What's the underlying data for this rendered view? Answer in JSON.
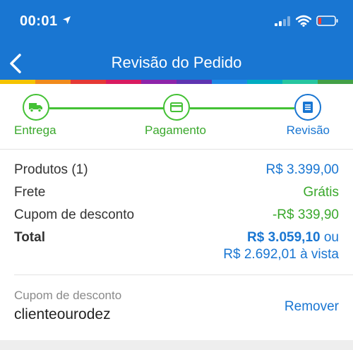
{
  "status_bar": {
    "time": "00:01",
    "icons": [
      "location-arrow-icon",
      "cellular-signal-icon",
      "wifi-icon",
      "low-battery-icon"
    ]
  },
  "nav": {
    "title": "Revisão do Pedido",
    "back_icon": "chevron-left-icon"
  },
  "colors": {
    "header": "#1976d2",
    "accent_green": "#44c135",
    "stripe": [
      "#f5c400",
      "#f08a1c",
      "#e53935",
      "#d81b60",
      "#8e24aa",
      "#5e35b1",
      "#1e88e5",
      "#00acc1",
      "#26c6a0",
      "#43a047"
    ]
  },
  "steps": [
    {
      "label": "Entrega",
      "icon": "truck-icon",
      "state": "done"
    },
    {
      "label": "Pagamento",
      "icon": "credit-card-icon",
      "state": "done"
    },
    {
      "label": "Revisão",
      "icon": "document-list-icon",
      "state": "current"
    }
  ],
  "summary": {
    "products_label": "Produtos (1)",
    "products_value": "R$ 3.399,00",
    "shipping_label": "Frete",
    "shipping_value": "Grátis",
    "coupon_label": "Cupom de desconto",
    "coupon_value": "-R$ 339,90",
    "total_label": "Total",
    "total_value": "R$ 3.059,10",
    "total_or": "ou",
    "total_cash": "R$ 2.692,01 à vista"
  },
  "coupon": {
    "caption": "Cupom de desconto",
    "code": "clienteourodez",
    "remove_label": "Remover"
  }
}
